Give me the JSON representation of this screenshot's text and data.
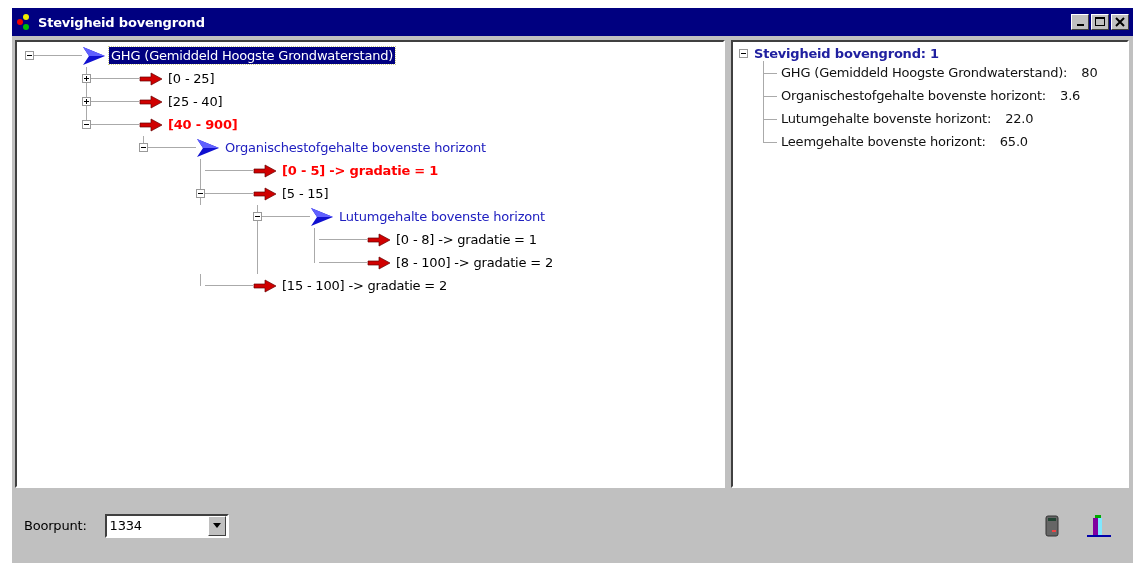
{
  "window": {
    "title": "Stevigheid bovengrond"
  },
  "decision_tree": {
    "nodes": [
      {
        "kind": "attribute",
        "label": "GHG (Gemiddeld Hoogste Grondwaterstand)",
        "selected": true,
        "highlight": false,
        "expanded": true,
        "children": [
          {
            "kind": "range",
            "label": "[0 - 25]",
            "selected": false,
            "highlight": false,
            "expanded": false
          },
          {
            "kind": "range",
            "label": "[25 - 40]",
            "selected": false,
            "highlight": false,
            "expanded": false
          },
          {
            "kind": "range",
            "label": "[40 - 900]",
            "selected": false,
            "highlight": true,
            "expanded": true,
            "children": [
              {
                "kind": "attribute",
                "label": "Organischestofgehalte bovenste horizont",
                "selected": false,
                "highlight": false,
                "expanded": true,
                "children": [
                  {
                    "kind": "range",
                    "label": "[0 - 5] -> gradatie = 1",
                    "selected": false,
                    "highlight": true
                  },
                  {
                    "kind": "range",
                    "label": "[5 - 15]",
                    "selected": false,
                    "highlight": false,
                    "expanded": true,
                    "children": [
                      {
                        "kind": "attribute",
                        "label": "Lutumgehalte bovenste horizont",
                        "selected": false,
                        "highlight": false,
                        "expanded": true,
                        "children": [
                          {
                            "kind": "range",
                            "label": "[0 - 8] -> gradatie = 1",
                            "selected": false,
                            "highlight": false
                          },
                          {
                            "kind": "range",
                            "label": "[8 - 100] -> gradatie = 2",
                            "selected": false,
                            "highlight": false
                          }
                        ]
                      }
                    ]
                  },
                  {
                    "kind": "range",
                    "label": "[15 - 100] -> gradatie = 2",
                    "selected": false,
                    "highlight": false
                  }
                ]
              }
            ]
          }
        ]
      }
    ]
  },
  "result": {
    "title": "Stevigheid bovengrond: 1",
    "expanded": true,
    "items": [
      {
        "label": "GHG (Gemiddeld Hoogste Grondwaterstand):",
        "value": "80"
      },
      {
        "label": "Organischestofgehalte bovenste horizont:",
        "value": "3.6"
      },
      {
        "label": "Lutumgehalte bovenste horizont:",
        "value": "22.0"
      },
      {
        "label": "Leemgehalte bovenste horizont:",
        "value": "65.0"
      }
    ]
  },
  "boorpunt": {
    "label": "Boorpunt:",
    "value": "1334"
  }
}
